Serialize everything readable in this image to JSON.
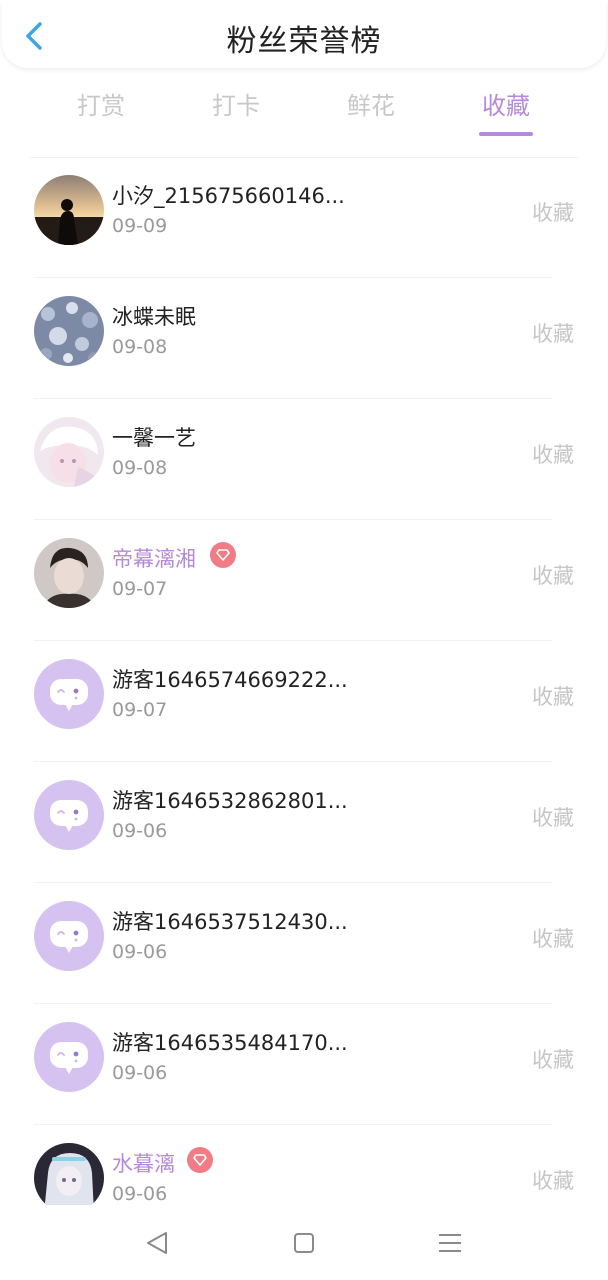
{
  "header": {
    "title": "粉丝荣誉榜",
    "back_icon": "chevron-left-icon"
  },
  "colors": {
    "accent": "#b58ad8",
    "back": "#3aa6e8",
    "badge": "#f17c86",
    "guest_avatar": "#d5c2f1"
  },
  "tabs": [
    {
      "label": "打赏",
      "active": false
    },
    {
      "label": "打卡",
      "active": false
    },
    {
      "label": "鲜花",
      "active": false
    },
    {
      "label": "收藏",
      "active": true
    }
  ],
  "list": {
    "items": [
      {
        "name": "小汐_215675660146...",
        "date": "09-09",
        "action": "收藏",
        "vip": false,
        "avatar": "sunset-photo"
      },
      {
        "name": "冰蝶未眠",
        "date": "09-08",
        "action": "收藏",
        "vip": false,
        "avatar": "blue-flowers"
      },
      {
        "name": "一馨一艺",
        "date": "09-08",
        "action": "收藏",
        "vip": false,
        "avatar": "anime-white-hair"
      },
      {
        "name": "帝幕漓湘",
        "date": "09-07",
        "action": "收藏",
        "vip": true,
        "avatar": "boy-portrait"
      },
      {
        "name": "游客1646574669222...",
        "date": "09-07",
        "action": "收藏",
        "vip": false,
        "avatar": "guest-chat-bubble"
      },
      {
        "name": "游客1646532862801...",
        "date": "09-06",
        "action": "收藏",
        "vip": false,
        "avatar": "guest-chat-bubble"
      },
      {
        "name": "游客1646537512430...",
        "date": "09-06",
        "action": "收藏",
        "vip": false,
        "avatar": "guest-chat-bubble"
      },
      {
        "name": "游客1646535484170...",
        "date": "09-06",
        "action": "收藏",
        "vip": false,
        "avatar": "guest-chat-bubble"
      },
      {
        "name": "水暮漓",
        "date": "09-06",
        "action": "收藏",
        "vip": true,
        "avatar": "anime-dark"
      }
    ]
  },
  "navbar": {
    "icons": [
      "back-triangle-icon",
      "home-square-icon",
      "menu-lines-icon"
    ]
  }
}
